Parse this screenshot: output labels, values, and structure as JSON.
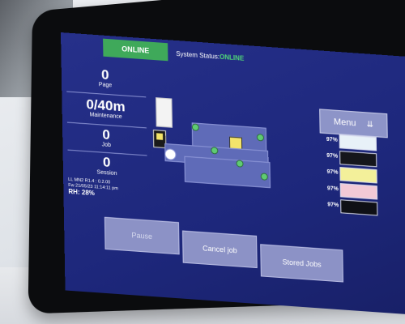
{
  "header": {
    "online_badge": "ONLINE",
    "status_label": "System Status:",
    "status_value": "ONLINE"
  },
  "stats": [
    {
      "value": "0",
      "label": "Page"
    },
    {
      "value": "0/40m",
      "label": "Maintenance"
    },
    {
      "value": "0",
      "label": "Job"
    },
    {
      "value": "0",
      "label": "Session"
    }
  ],
  "meta_lines": [
    "LL MN2 R1.4 : 0.2.00",
    "Fw 21/05/23 11:14:11 pm"
  ],
  "humidity": "RH: 28%",
  "menu": {
    "label": "Menu",
    "icon": "sort-icon"
  },
  "inks": [
    {
      "pct": "97%",
      "color": "#e8f1f8"
    },
    {
      "pct": "97%",
      "color": "#15161c"
    },
    {
      "pct": "97%",
      "color": "#f3f09a"
    },
    {
      "pct": "97%",
      "color": "#f2c9d6"
    },
    {
      "pct": "97%",
      "color": "#0f1016"
    }
  ],
  "buttons": {
    "pause": "Pause",
    "cancel_job": "Cancel job",
    "stored_jobs": "Stored Jobs"
  }
}
